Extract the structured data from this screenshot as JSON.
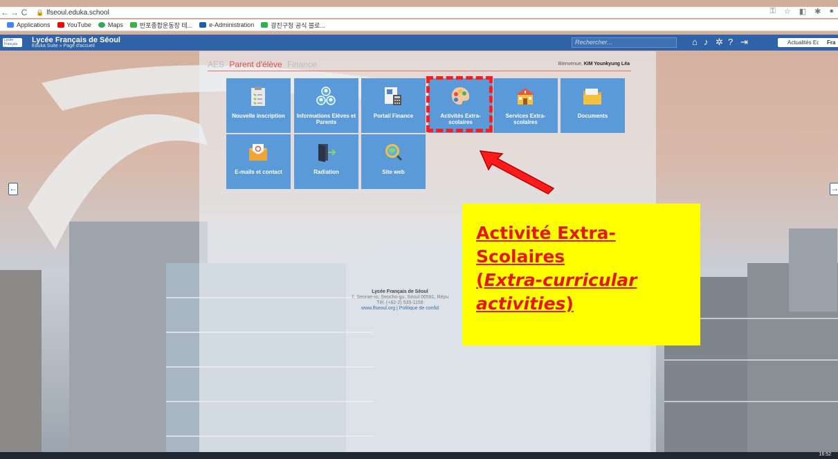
{
  "browser": {
    "url": "lfseoul.eduka.school",
    "bookmarks": [
      "Applications",
      "YouTube",
      "Maps",
      "반포종합운동장 테...",
      "e-Administration",
      "광진구청 공식 블로..."
    ],
    "bookmark_colors": [
      "#4285f4",
      "#ff0000",
      "#34a853",
      "#3bb34a",
      "#1a5fa8",
      "#2eb24e"
    ]
  },
  "header": {
    "logo_text": "Lycée Français Séoul",
    "school_name": "Lycée Français de Séoul",
    "breadcrumb": "Eduka Suite » Page d'accueil",
    "search_placeholder": "Rechercher...",
    "tools": [
      "home-icon",
      "bell-icon",
      "settings-icon",
      "help-icon",
      "logout-icon"
    ],
    "news_button": "Actualités Eduka",
    "language": "Fra",
    "accent": "#2f62a6"
  },
  "portal": {
    "tabs": [
      "AES",
      "Parent d'élève",
      "Finance"
    ],
    "active_tab": "Parent d'élève",
    "welcome_prefix": "Bienvenue,",
    "welcome_name": "KIM Younkyung Léa",
    "tiles": [
      {
        "label": "Nouvelle inscription",
        "icon": "clipboard-icon"
      },
      {
        "label": "Informations Elèves et Parents",
        "icon": "people-icon"
      },
      {
        "label": "Portail Finance",
        "icon": "invoice-icon"
      },
      {
        "label": "Activités Extra-scolaires",
        "icon": "palette-icon"
      },
      {
        "label": "Services Extra-scolaires",
        "icon": "school-icon"
      },
      {
        "label": "Documents",
        "icon": "folder-icon"
      },
      {
        "label": "E-mails et contact",
        "icon": "envelope-icon"
      },
      {
        "label": "Radiation",
        "icon": "exit-door-icon"
      },
      {
        "label": "Site web",
        "icon": "globe-search-icon"
      }
    ],
    "tile_color": "#5a9ad8"
  },
  "annotation": {
    "line1": "Activité Extra-",
    "line2": "Scolaires",
    "line3a": "(",
    "line3b": "Extra-curricular",
    "line4a": "activities",
    "line4b": ")",
    "highlight_color": "#ffff00",
    "text_color": "#e31919"
  },
  "footer": {
    "name": "Lycée Français de Séoul",
    "address": "7, Seorae-ro, Seocho-gu, Séoul 06581, Répu",
    "tel": "Tél. (+82-2) 535-1158",
    "links": "www.lfseoul.org | Politique de confid"
  },
  "taskbar": {
    "time": "16:52"
  }
}
